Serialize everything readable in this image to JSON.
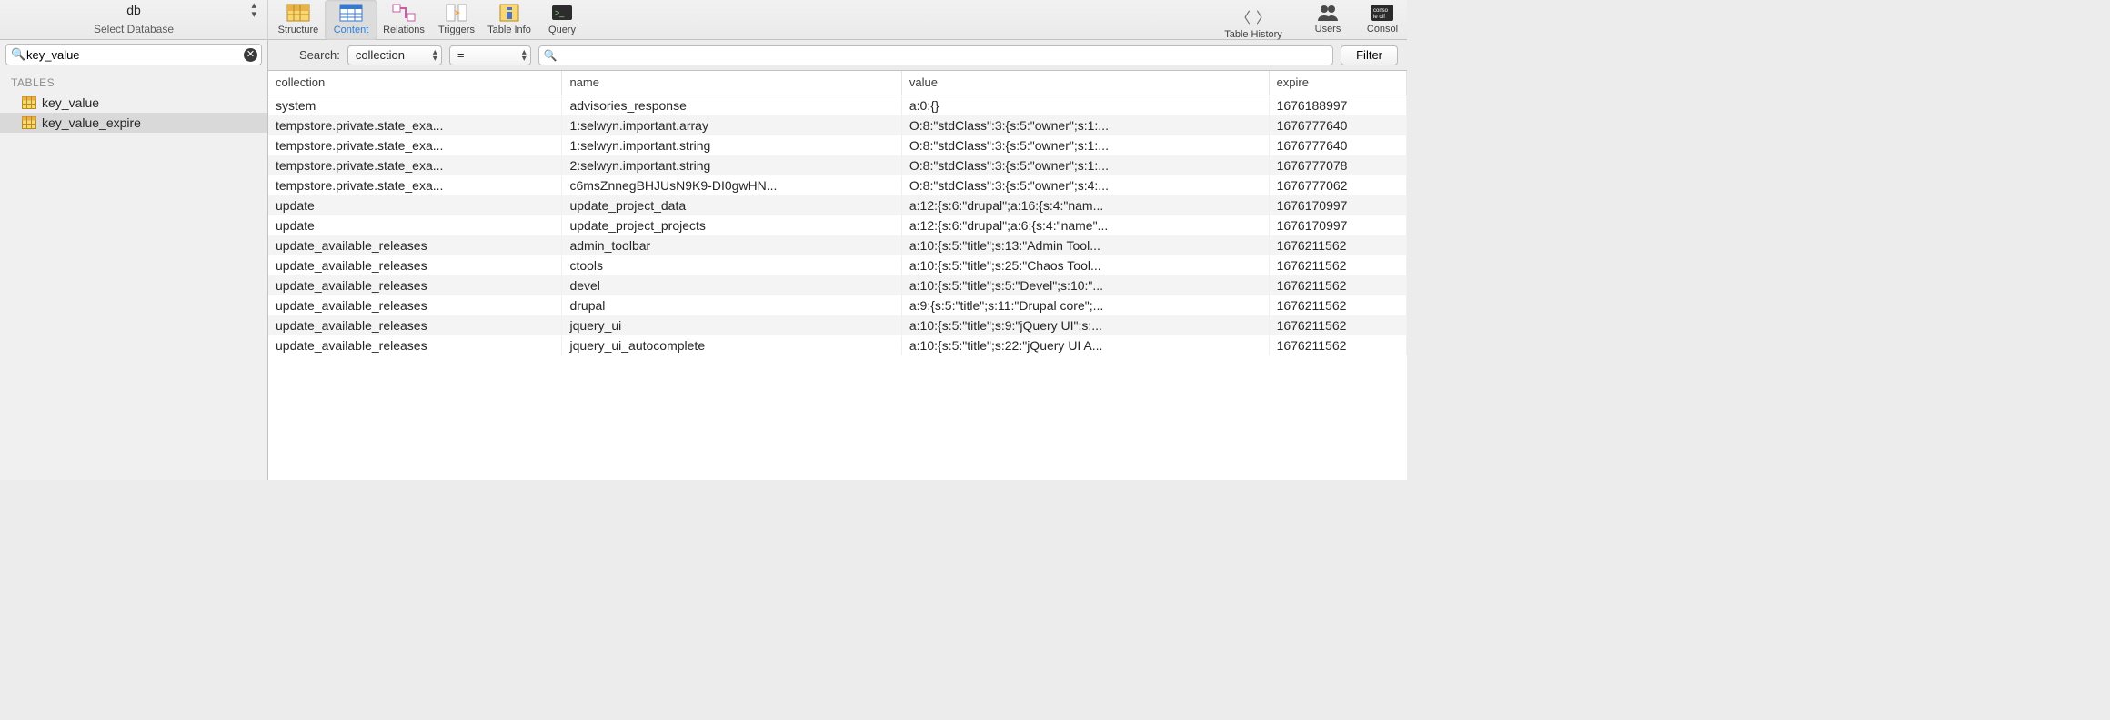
{
  "db_selector": {
    "value": "db",
    "caption": "Select Database"
  },
  "toolbar_tabs": [
    {
      "id": "structure",
      "label": "Structure"
    },
    {
      "id": "content",
      "label": "Content",
      "active": true
    },
    {
      "id": "relations",
      "label": "Relations"
    },
    {
      "id": "triggers",
      "label": "Triggers"
    },
    {
      "id": "tableinfo",
      "label": "Table Info"
    },
    {
      "id": "query",
      "label": "Query"
    }
  ],
  "right_tabs": {
    "history": "Table History",
    "users": "Users",
    "console": "Consol"
  },
  "sidebar": {
    "search_value": "key_value",
    "header": "TABLES",
    "tables": [
      {
        "name": "key_value",
        "selected": false
      },
      {
        "name": "key_value_expire",
        "selected": true
      }
    ]
  },
  "filter": {
    "search_label": "Search:",
    "column_selected": "collection",
    "operator_selected": "=",
    "value": "",
    "button": "Filter"
  },
  "columns": [
    "collection",
    "name",
    "value",
    "expire"
  ],
  "rows": [
    {
      "collection": "system",
      "name": "advisories_response",
      "value": "a:0:{}",
      "expire": "1676188997"
    },
    {
      "collection": "tempstore.private.state_exa...",
      "name": "1:selwyn.important.array",
      "value": "O:8:\"stdClass\":3:{s:5:\"owner\";s:1:...",
      "expire": "1676777640"
    },
    {
      "collection": "tempstore.private.state_exa...",
      "name": "1:selwyn.important.string",
      "value": "O:8:\"stdClass\":3:{s:5:\"owner\";s:1:...",
      "expire": "1676777640"
    },
    {
      "collection": "tempstore.private.state_exa...",
      "name": "2:selwyn.important.string",
      "value": "O:8:\"stdClass\":3:{s:5:\"owner\";s:1:...",
      "expire": "1676777078"
    },
    {
      "collection": "tempstore.private.state_exa...",
      "name": "c6msZnnegBHJUsN9K9-DI0gwHN...",
      "value": "O:8:\"stdClass\":3:{s:5:\"owner\";s:4:...",
      "expire": "1676777062"
    },
    {
      "collection": "update",
      "name": "update_project_data",
      "value": "a:12:{s:6:\"drupal\";a:16:{s:4:\"nam...",
      "expire": "1676170997"
    },
    {
      "collection": "update",
      "name": "update_project_projects",
      "value": "a:12:{s:6:\"drupal\";a:6:{s:4:\"name\"...",
      "expire": "1676170997"
    },
    {
      "collection": "update_available_releases",
      "name": "admin_toolbar",
      "value": "a:10:{s:5:\"title\";s:13:\"Admin Tool...",
      "expire": "1676211562"
    },
    {
      "collection": "update_available_releases",
      "name": "ctools",
      "value": "a:10:{s:5:\"title\";s:25:\"Chaos Tool...",
      "expire": "1676211562"
    },
    {
      "collection": "update_available_releases",
      "name": "devel",
      "value": "a:10:{s:5:\"title\";s:5:\"Devel\";s:10:\"...",
      "expire": "1676211562"
    },
    {
      "collection": "update_available_releases",
      "name": "drupal",
      "value": "a:9:{s:5:\"title\";s:11:\"Drupal core\";...",
      "expire": "1676211562"
    },
    {
      "collection": "update_available_releases",
      "name": "jquery_ui",
      "value": "a:10:{s:5:\"title\";s:9:\"jQuery UI\";s:...",
      "expire": "1676211562"
    },
    {
      "collection": "update_available_releases",
      "name": "jquery_ui_autocomplete",
      "value": "a:10:{s:5:\"title\";s:22:\"jQuery UI A...",
      "expire": "1676211562"
    }
  ]
}
